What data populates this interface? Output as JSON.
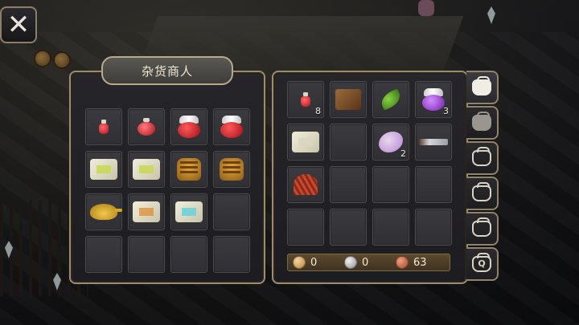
{
  "close_button": {
    "label": "✕"
  },
  "merchant": {
    "title": "杂货商人",
    "slots": [
      {
        "icon": "red-potion-small-icon",
        "kind": "potion-small",
        "qty": ""
      },
      {
        "icon": "red-potion-round-icon",
        "kind": "potion-round",
        "qty": ""
      },
      {
        "icon": "red-potion-large-icon",
        "kind": "potion-big",
        "qty": ""
      },
      {
        "icon": "red-potion-winged-icon",
        "kind": "potion-big",
        "qty": ""
      },
      {
        "icon": "green-scroll-icon",
        "kind": "scroll green",
        "qty": ""
      },
      {
        "icon": "green-scroll-icon",
        "kind": "scroll green",
        "qty": ""
      },
      {
        "icon": "armor-icon",
        "kind": "armor",
        "qty": ""
      },
      {
        "icon": "armor-icon",
        "kind": "armor",
        "qty": ""
      },
      {
        "icon": "magic-lamp-icon",
        "kind": "lamp",
        "qty": ""
      },
      {
        "icon": "orange-scroll-icon",
        "kind": "scroll orange",
        "qty": ""
      },
      {
        "icon": "cyan-scroll-icon",
        "kind": "scroll cyan",
        "qty": ""
      },
      {
        "icon": "",
        "kind": "",
        "qty": ""
      },
      {
        "icon": "",
        "kind": "",
        "qty": ""
      },
      {
        "icon": "",
        "kind": "",
        "qty": ""
      },
      {
        "icon": "",
        "kind": "",
        "qty": ""
      },
      {
        "icon": "",
        "kind": "",
        "qty": ""
      }
    ]
  },
  "bag": {
    "slots": [
      {
        "icon": "red-potion-small-icon",
        "kind": "potion-small",
        "qty": "8"
      },
      {
        "icon": "leather-icon",
        "kind": "leather",
        "qty": ""
      },
      {
        "icon": "herb-leaf-icon",
        "kind": "leaf",
        "qty": ""
      },
      {
        "icon": "purple-potion-icon",
        "kind": "potion-big potion-purple",
        "qty": "3"
      },
      {
        "icon": "scroll-icon",
        "kind": "scroll plain",
        "qty": ""
      },
      {
        "icon": "",
        "kind": "",
        "qty": ""
      },
      {
        "icon": "fairy-wing-icon",
        "kind": "wing",
        "qty": "2"
      },
      {
        "icon": "dagger-icon",
        "kind": "dagger",
        "qty": ""
      },
      {
        "icon": "red-feather-icon",
        "kind": "feather",
        "qty": ""
      },
      {
        "icon": "",
        "kind": "",
        "qty": ""
      },
      {
        "icon": "",
        "kind": "",
        "qty": ""
      },
      {
        "icon": "",
        "kind": "",
        "qty": ""
      },
      {
        "icon": "",
        "kind": "",
        "qty": ""
      },
      {
        "icon": "",
        "kind": "",
        "qty": ""
      },
      {
        "icon": "",
        "kind": "",
        "qty": ""
      },
      {
        "icon": "",
        "kind": "",
        "qty": ""
      }
    ],
    "currency": {
      "gold": "0",
      "silver": "0",
      "copper": "63"
    }
  },
  "tabs": [
    {
      "icon": "bag-icon",
      "state": "active"
    },
    {
      "icon": "bag-icon",
      "state": "filled"
    },
    {
      "icon": "bag-icon",
      "state": "outline"
    },
    {
      "icon": "bag-icon",
      "state": "outline"
    },
    {
      "icon": "bag-icon",
      "state": "outline"
    },
    {
      "icon": "quest-bag-icon",
      "state": "quest"
    }
  ]
}
